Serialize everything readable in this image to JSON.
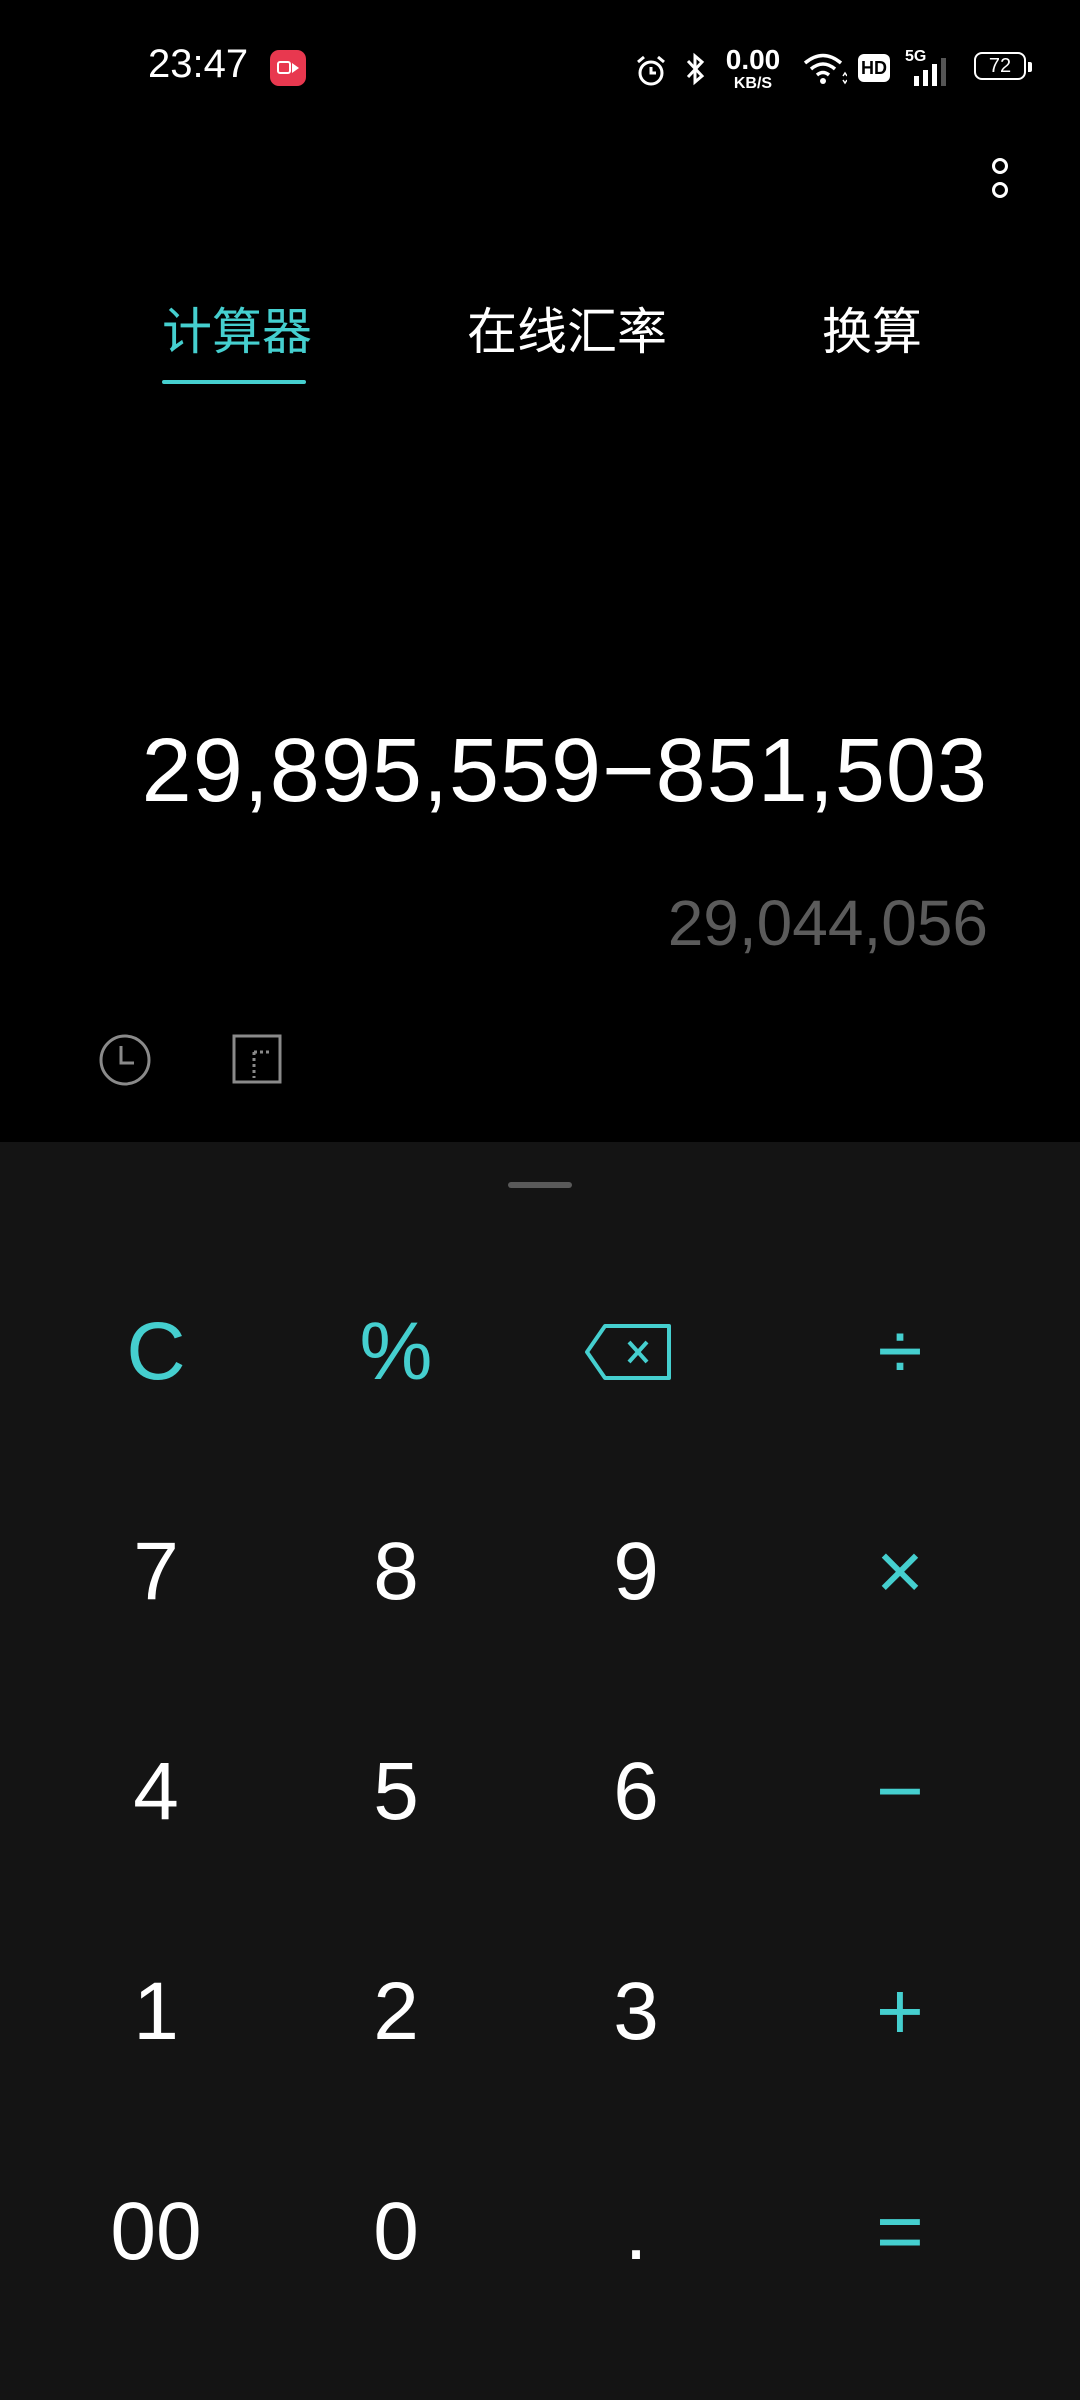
{
  "status_bar": {
    "time": "23:47",
    "net_speed_value": "0.00",
    "net_speed_unit": "KB/S",
    "hd_label": "HD",
    "network_label": "5G",
    "battery": "72",
    "icons": [
      "screen-record-icon",
      "alarm-icon",
      "bluetooth-icon",
      "wifi-icon",
      "signal-icon",
      "battery-icon"
    ]
  },
  "tabs": [
    {
      "label": "计算器",
      "active": true
    },
    {
      "label": "在线汇率",
      "active": false
    },
    {
      "label": "换算",
      "active": false
    }
  ],
  "display": {
    "expression": "29,895,559−851,503",
    "result": "29,044,056"
  },
  "keys": {
    "clear": "C",
    "percent": "%",
    "divide": "÷",
    "seven": "7",
    "eight": "8",
    "nine": "9",
    "multiply": "×",
    "four": "4",
    "five": "5",
    "six": "6",
    "minus": "−",
    "one": "1",
    "two": "2",
    "three": "3",
    "plus": "+",
    "double_zero": "00",
    "zero": "0",
    "dot": ".",
    "equals": "="
  },
  "colors": {
    "accent": "#45cfcf",
    "background": "#000000",
    "keypad_background": "#141414",
    "result_text": "#5b5b5b",
    "record_badge": "#e8384f"
  }
}
